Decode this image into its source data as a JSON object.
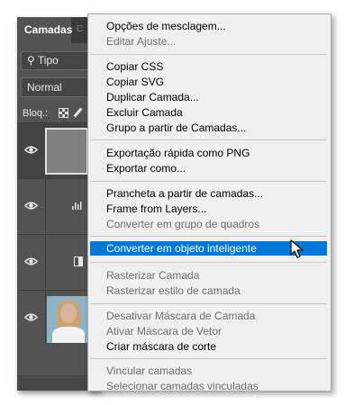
{
  "layers_panel": {
    "tab_active": "Camadas",
    "tab_next": "C",
    "filter_label": "Tipo",
    "blend_mode": "Normal",
    "lock_label": "Bloq.:",
    "layers": [
      {
        "kind": "gray-fill",
        "visible": true,
        "selected": true
      },
      {
        "kind": "adjustment",
        "visible": true,
        "selected": false
      },
      {
        "kind": "frame",
        "visible": true,
        "selected": false
      },
      {
        "kind": "photo",
        "visible": true,
        "selected": false
      }
    ]
  },
  "context_menu": {
    "items": [
      {
        "label": "Opções de mesclagem...",
        "enabled": true
      },
      {
        "label": "Editar Ajuste...",
        "enabled": false
      },
      {
        "label": "Copiar CSS",
        "enabled": true
      },
      {
        "label": "Copiar SVG",
        "enabled": true
      },
      {
        "label": "Duplicar Camada...",
        "enabled": true
      },
      {
        "label": "Excluir Camada",
        "enabled": true
      },
      {
        "label": "Grupo a partir de Camadas...",
        "enabled": true
      },
      {
        "label": "Exportação rápida como PNG",
        "enabled": true
      },
      {
        "label": "Exportar como...",
        "enabled": true
      },
      {
        "label": "Prancheta a partir de camadas...",
        "enabled": true
      },
      {
        "label": "Frame from Layers...",
        "enabled": true
      },
      {
        "label": "Converter em grupo de quadros",
        "enabled": false
      },
      {
        "label": "Converter em objeto inteligente",
        "enabled": true,
        "highlighted": true
      },
      {
        "label": "Rasterizar Camada",
        "enabled": false
      },
      {
        "label": "Rasterizar estilo de camada",
        "enabled": false
      },
      {
        "label": "Desativar Máscara de Camada",
        "enabled": false
      },
      {
        "label": "Ativar Máscara de Vetor",
        "enabled": false
      },
      {
        "label": "Criar máscara de corte",
        "enabled": true
      },
      {
        "label": "Vincular camadas",
        "enabled": false
      },
      {
        "label": "Selecionar camadas vinculadas",
        "enabled": false
      }
    ]
  },
  "colors": {
    "panel_bg": "#535353",
    "menu_bg": "#f0f0f0",
    "highlight": "#0078d7",
    "disabled_text": "#6d6d6d"
  }
}
